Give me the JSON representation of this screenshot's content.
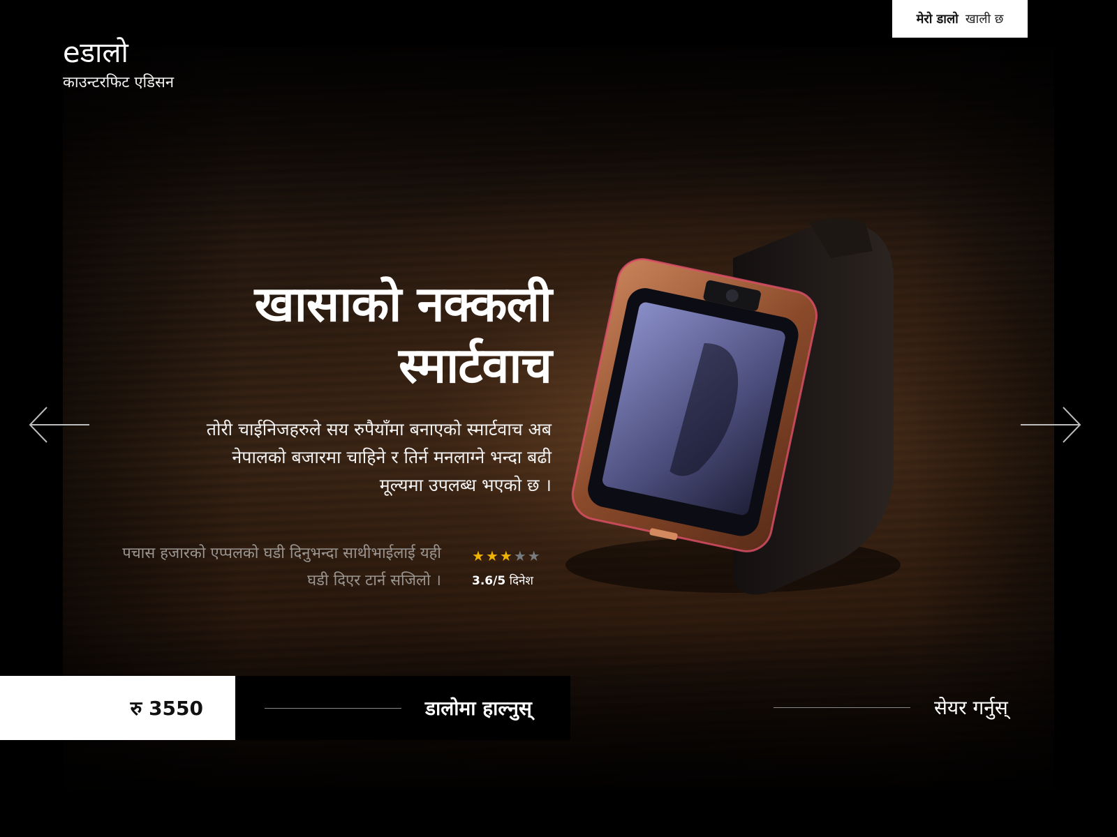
{
  "brand": {
    "name": "eडालो",
    "tagline": "काउन्टरफिट एडिसन"
  },
  "cart": {
    "label": "मेरो डालो",
    "status": "खाली छ"
  },
  "hero": {
    "title_line1": "खासाको नक्कली",
    "title_line2": "स्मार्टवाच",
    "description": "तोरी चाईनिजहरुले सय रुपैयाँमा बनाएको स्मार्टवाच अब नेपालको बजारमा चाहिने र तिर्न मनलाग्ने भन्दा बढी मूल्यमा उपलब्ध भएको छ ।"
  },
  "review": {
    "quote": "पचास हजारको एप्पलको घडी दिनुभन्दा साथीभाईलाई यही घडी दिएर टार्न सजिलो ।",
    "rating": 3.6,
    "rating_max": 5,
    "rating_display": "3.6/5",
    "reviewer": "दिनेश",
    "stars_filled": 3,
    "stars_total": 5
  },
  "product": {
    "price": "रु 3550",
    "add_to_cart_label": "डालोमा हाल्नुस्",
    "share_label": "सेयर गर्नुस्"
  },
  "navigation": {
    "prev_icon": "arrow-left-icon",
    "next_icon": "arrow-right-icon"
  },
  "colors": {
    "star_on": "#f0b400",
    "star_off": "#777c80",
    "background": "#000000"
  }
}
